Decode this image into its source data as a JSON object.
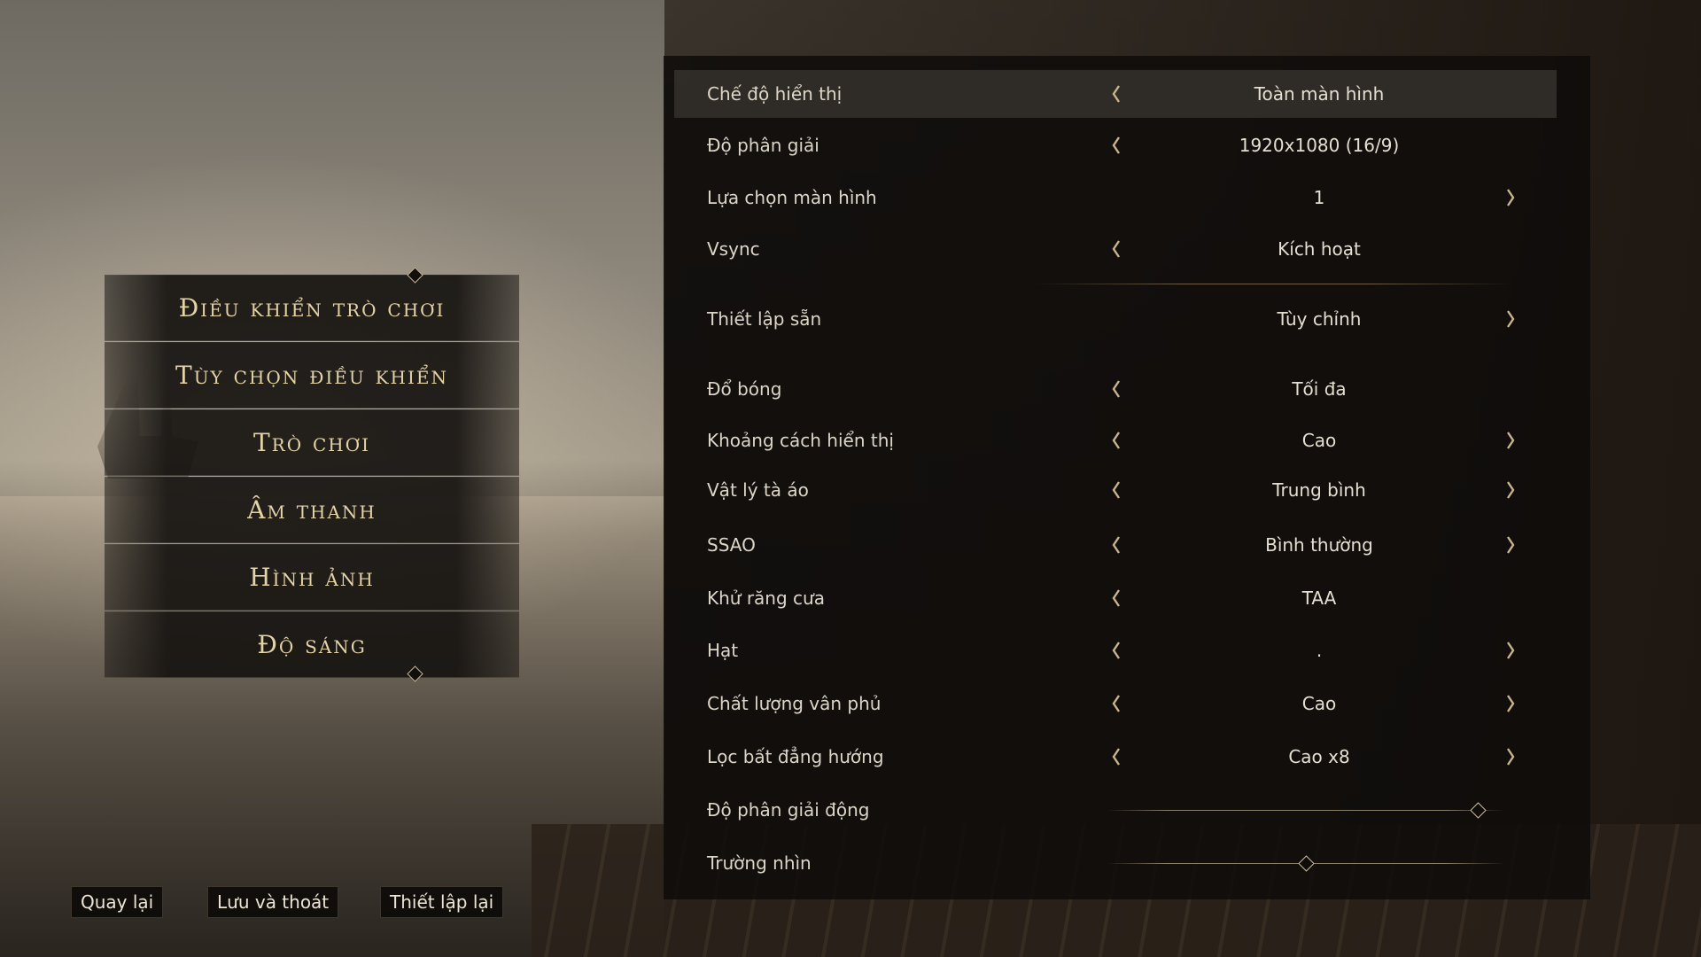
{
  "menu": {
    "items": [
      {
        "label": "Điều khiển trò chơi"
      },
      {
        "label": "Tùy chọn điều khiển"
      },
      {
        "label": "Trò chơi"
      },
      {
        "label": "Âm thanh"
      },
      {
        "label": "Hình ảnh"
      },
      {
        "label": "Độ sáng"
      }
    ]
  },
  "bottom_buttons": {
    "back": "Quay lại",
    "save_exit": "Lưu và thoát",
    "reset": "Thiết lập lại"
  },
  "settings": {
    "rows": [
      {
        "label": "Chế độ hiển thị",
        "value": "Toàn màn hình",
        "left_arrow": true,
        "right_arrow": false,
        "selected": true
      },
      {
        "label": "Độ phân giải",
        "value": "1920x1080 (16/9)",
        "left_arrow": true,
        "right_arrow": false
      },
      {
        "label": "Lựa chọn màn hình",
        "value": "1",
        "left_arrow": false,
        "right_arrow": true
      },
      {
        "label": "Vsync",
        "value": "Kích hoạt",
        "left_arrow": true,
        "right_arrow": false
      },
      {
        "label": "Thiết lập sẵn",
        "value": "Tùy chỉnh",
        "left_arrow": false,
        "right_arrow": true
      },
      {
        "label": "Đổ bóng",
        "value": "Tối đa",
        "left_arrow": true,
        "right_arrow": false
      },
      {
        "label": "Khoảng cách hiển thị",
        "value": "Cao",
        "left_arrow": true,
        "right_arrow": true
      },
      {
        "label": "Vật lý tà áo",
        "value": "Trung bình",
        "left_arrow": true,
        "right_arrow": true
      },
      {
        "label": "SSAO",
        "value": "Bình thường",
        "left_arrow": true,
        "right_arrow": true
      },
      {
        "label": "Khử răng cưa",
        "value": "TAA",
        "left_arrow": true,
        "right_arrow": false
      },
      {
        "label": "Hạt",
        "value": ".",
        "left_arrow": true,
        "right_arrow": true
      },
      {
        "label": "Chất lượng vân phủ",
        "value": "Cao",
        "left_arrow": true,
        "right_arrow": true
      },
      {
        "label": "Lọc bất đẳng hướng",
        "value": "Cao x8",
        "left_arrow": true,
        "right_arrow": true
      }
    ],
    "sliders": [
      {
        "label": "Độ phân giải động",
        "level": 0.93
      },
      {
        "label": "Trường nhìn",
        "level": 0.5
      }
    ]
  },
  "colors": {
    "menu_text": "#e4d3a6",
    "panel_bg": "#0e0c0a",
    "accent_line": "#aa966e"
  }
}
